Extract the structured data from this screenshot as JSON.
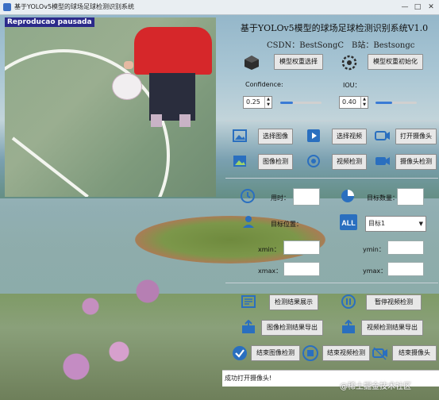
{
  "window": {
    "title": "基于YOLOv5模型的球场足球检测识别系统"
  },
  "video": {
    "watermark": "Reproducao pausada"
  },
  "header": {
    "title": "基于YOLOv5模型的球场足球检测识别系统V1.0",
    "csdn_label": "CSDN：BestSongC",
    "bili_label": "B站：Bestsongc"
  },
  "model": {
    "select_label": "模型权重选择",
    "init_label": "模型权重初始化"
  },
  "confidence": {
    "label": "Confidence:",
    "value": "0.25",
    "fill_percent": 30
  },
  "iou": {
    "label": "IOU：",
    "value": "0.40",
    "fill_percent": 40
  },
  "sources": {
    "select_image": "选择图像",
    "select_video": "选择视频",
    "open_camera": "打开摄像头",
    "image_detect": "图像检测",
    "video_detect": "视频检测",
    "camera_detect": "摄像头检测"
  },
  "info": {
    "time_label": "用时：",
    "count_label": "目标数量：",
    "position_label": "目标位置：",
    "target_select": "目标1",
    "xmin_label": "xmin：",
    "ymin_label": "ymin：",
    "xmax_label": "xmax：",
    "ymax_label": "ymax："
  },
  "actions": {
    "show_result": "检测结果展示",
    "pause_video": "暂停视频检测",
    "export_image": "图像检测结果导出",
    "export_video": "视频检测结果导出",
    "end_image": "结束图像检测",
    "end_video": "结束视频检测",
    "end_camera": "结束摄像头"
  },
  "status": {
    "message": "成功打开摄像头!"
  },
  "corner_watermark": "@稀土掘金技术社区",
  "colors": {
    "accent": "#3a7bd5",
    "wm_bg": "#2c2a8a"
  }
}
